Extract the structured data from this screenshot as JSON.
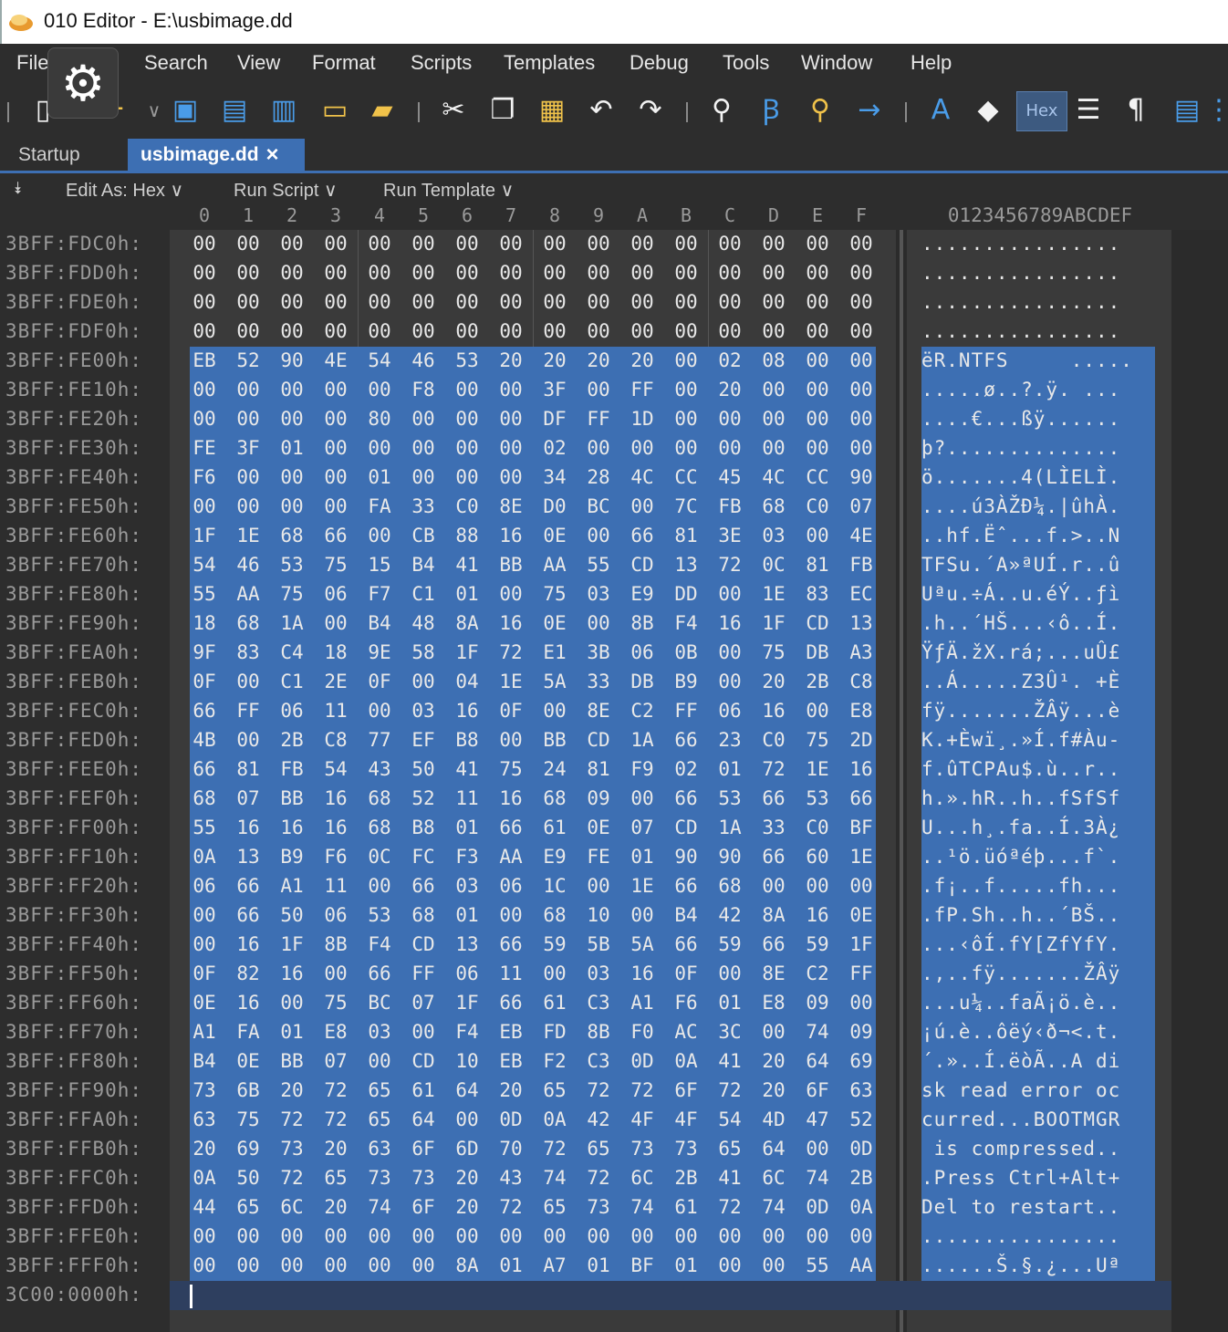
{
  "window": {
    "title": "010 Editor - E:\\usbimage.dd"
  },
  "menu": [
    "File",
    "Search",
    "View",
    "Format",
    "Scripts",
    "Templates",
    "Debug",
    "Tools",
    "Window",
    "Help"
  ],
  "tabs": {
    "startup": "Startup",
    "active": "usbimage.dd",
    "close": "×"
  },
  "subbar": {
    "edit_as": "Edit As: Hex",
    "run_script": "Run Script",
    "run_template": "Run Template",
    "chev": "∨"
  },
  "toolbar": {
    "hex_label": "Hex"
  },
  "column_header": {
    "hex": [
      "0",
      "1",
      "2",
      "3",
      "4",
      "5",
      "6",
      "7",
      "8",
      "9",
      "A",
      "B",
      "C",
      "D",
      "E",
      "F"
    ],
    "ascii": "0123456789ABCDEF"
  },
  "rows": [
    {
      "addr": "3BFF:FDC0h:",
      "bytes": "00 00 00 00 00 00 00 00 00 00 00 00 00 00 00 00",
      "ascii": "................"
    },
    {
      "addr": "3BFF:FDD0h:",
      "bytes": "00 00 00 00 00 00 00 00 00 00 00 00 00 00 00 00",
      "ascii": "................"
    },
    {
      "addr": "3BFF:FDE0h:",
      "bytes": "00 00 00 00 00 00 00 00 00 00 00 00 00 00 00 00",
      "ascii": "................"
    },
    {
      "addr": "3BFF:FDF0h:",
      "bytes": "00 00 00 00 00 00 00 00 00 00 00 00 00 00 00 00",
      "ascii": "................"
    },
    {
      "addr": "3BFF:FE00h:",
      "bytes": "EB 52 90 4E 54 46 53 20 20 20 20 00 02 08 00 00",
      "ascii": "ëR.NTFS     ....."
    },
    {
      "addr": "3BFF:FE10h:",
      "bytes": "00 00 00 00 00 F8 00 00 3F 00 FF 00 20 00 00 00",
      "ascii": ".....ø..?.ÿ. ..."
    },
    {
      "addr": "3BFF:FE20h:",
      "bytes": "00 00 00 00 80 00 00 00 DF FF 1D 00 00 00 00 00",
      "ascii": "....€...ßÿ......"
    },
    {
      "addr": "3BFF:FE30h:",
      "bytes": "FE 3F 01 00 00 00 00 00 02 00 00 00 00 00 00 00",
      "ascii": "þ?.............."
    },
    {
      "addr": "3BFF:FE40h:",
      "bytes": "F6 00 00 00 01 00 00 00 34 28 4C CC 45 4C CC 90",
      "ascii": "ö.......4(LÌELÌ."
    },
    {
      "addr": "3BFF:FE50h:",
      "bytes": "00 00 00 00 FA 33 C0 8E D0 BC 00 7C FB 68 C0 07",
      "ascii": "....ú3ÀŽÐ¼.|ûhÀ."
    },
    {
      "addr": "3BFF:FE60h:",
      "bytes": "1F 1E 68 66 00 CB 88 16 0E 00 66 81 3E 03 00 4E",
      "ascii": "..hf.Ëˆ...f.>..N"
    },
    {
      "addr": "3BFF:FE70h:",
      "bytes": "54 46 53 75 15 B4 41 BB AA 55 CD 13 72 0C 81 FB",
      "ascii": "TFSu.´A»ªUÍ.r..û"
    },
    {
      "addr": "3BFF:FE80h:",
      "bytes": "55 AA 75 06 F7 C1 01 00 75 03 E9 DD 00 1E 83 EC",
      "ascii": "Uªu.÷Á..u.éÝ..ƒì"
    },
    {
      "addr": "3BFF:FE90h:",
      "bytes": "18 68 1A 00 B4 48 8A 16 0E 00 8B F4 16 1F CD 13",
      "ascii": ".h..´HŠ...‹ô..Í."
    },
    {
      "addr": "3BFF:FEA0h:",
      "bytes": "9F 83 C4 18 9E 58 1F 72 E1 3B 06 0B 00 75 DB A3",
      "ascii": "ŸƒÄ.žX.rá;...uÛ£"
    },
    {
      "addr": "3BFF:FEB0h:",
      "bytes": "0F 00 C1 2E 0F 00 04 1E 5A 33 DB B9 00 20 2B C8",
      "ascii": "..Á.....Z3Û¹. +È"
    },
    {
      "addr": "3BFF:FEC0h:",
      "bytes": "66 FF 06 11 00 03 16 0F 00 8E C2 FF 06 16 00 E8",
      "ascii": "fÿ.......ŽÂÿ...è"
    },
    {
      "addr": "3BFF:FED0h:",
      "bytes": "4B 00 2B C8 77 EF B8 00 BB CD 1A 66 23 C0 75 2D",
      "ascii": "K.+Èwï¸.»Í.f#Àu-"
    },
    {
      "addr": "3BFF:FEE0h:",
      "bytes": "66 81 FB 54 43 50 41 75 24 81 F9 02 01 72 1E 16",
      "ascii": "f.ûTCPAu$.ù..r.."
    },
    {
      "addr": "3BFF:FEF0h:",
      "bytes": "68 07 BB 16 68 52 11 16 68 09 00 66 53 66 53 66",
      "ascii": "h.».hR..h..fSfSf"
    },
    {
      "addr": "3BFF:FF00h:",
      "bytes": "55 16 16 16 68 B8 01 66 61 0E 07 CD 1A 33 C0 BF",
      "ascii": "U...h¸.fa..Í.3À¿"
    },
    {
      "addr": "3BFF:FF10h:",
      "bytes": "0A 13 B9 F6 0C FC F3 AA E9 FE 01 90 90 66 60 1E",
      "ascii": "..¹ö.üóªéþ...f`."
    },
    {
      "addr": "3BFF:FF20h:",
      "bytes": "06 66 A1 11 00 66 03 06 1C 00 1E 66 68 00 00 00",
      "ascii": ".f¡..f.....fh..."
    },
    {
      "addr": "3BFF:FF30h:",
      "bytes": "00 66 50 06 53 68 01 00 68 10 00 B4 42 8A 16 0E",
      "ascii": ".fP.Sh..h..´BŠ.."
    },
    {
      "addr": "3BFF:FF40h:",
      "bytes": "00 16 1F 8B F4 CD 13 66 59 5B 5A 66 59 66 59 1F",
      "ascii": "...‹ôÍ.fY[ZfYfY."
    },
    {
      "addr": "3BFF:FF50h:",
      "bytes": "0F 82 16 00 66 FF 06 11 00 03 16 0F 00 8E C2 FF",
      "ascii": ".‚..fÿ.......ŽÂÿ"
    },
    {
      "addr": "3BFF:FF60h:",
      "bytes": "0E 16 00 75 BC 07 1F 66 61 C3 A1 F6 01 E8 09 00",
      "ascii": "...u¼..faÃ¡ö.è.."
    },
    {
      "addr": "3BFF:FF70h:",
      "bytes": "A1 FA 01 E8 03 00 F4 EB FD 8B F0 AC 3C 00 74 09",
      "ascii": "¡ú.è..ôëý‹ð¬<.t."
    },
    {
      "addr": "3BFF:FF80h:",
      "bytes": "B4 0E BB 07 00 CD 10 EB F2 C3 0D 0A 41 20 64 69",
      "ascii": "´.»..Í.ëòÃ..A di"
    },
    {
      "addr": "3BFF:FF90h:",
      "bytes": "73 6B 20 72 65 61 64 20 65 72 72 6F 72 20 6F 63",
      "ascii": "sk read error oc"
    },
    {
      "addr": "3BFF:FFA0h:",
      "bytes": "63 75 72 72 65 64 00 0D 0A 42 4F 4F 54 4D 47 52",
      "ascii": "curred...BOOTMGR"
    },
    {
      "addr": "3BFF:FFB0h:",
      "bytes": "20 69 73 20 63 6F 6D 70 72 65 73 73 65 64 00 0D",
      "ascii": " is compressed.."
    },
    {
      "addr": "3BFF:FFC0h:",
      "bytes": "0A 50 72 65 73 73 20 43 74 72 6C 2B 41 6C 74 2B",
      "ascii": ".Press Ctrl+Alt+"
    },
    {
      "addr": "3BFF:FFD0h:",
      "bytes": "44 65 6C 20 74 6F 20 72 65 73 74 61 72 74 0D 0A",
      "ascii": "Del to restart.."
    },
    {
      "addr": "3BFF:FFE0h:",
      "bytes": "00 00 00 00 00 00 00 00 00 00 00 00 00 00 00 00",
      "ascii": "................"
    },
    {
      "addr": "3BFF:FFF0h:",
      "bytes": "00 00 00 00 00 00 8A 01 A7 01 BF 01 00 00 55 AA",
      "ascii": "......Š.§.¿...Uª"
    },
    {
      "addr": "3C00:0000h:",
      "bytes": "",
      "ascii": ""
    }
  ],
  "icon_colors": {
    "blue": "#4a9ce8",
    "yellow": "#f0c24a",
    "white": "#f2f2f2",
    "selection": "#3d6fb3"
  }
}
